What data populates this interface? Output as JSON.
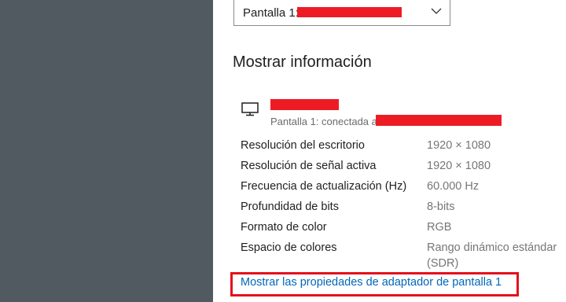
{
  "display_selector": {
    "label": "Pantalla 1:",
    "icon": "chevron-down-icon"
  },
  "section": {
    "title": "Mostrar información"
  },
  "display": {
    "icon": "monitor-icon",
    "connection": "Pantalla 1: conectada a"
  },
  "info_rows": [
    {
      "label": "Resolución del escritorio",
      "value": "1920 × 1080"
    },
    {
      "label": "Resolución de señal activa",
      "value": "1920 × 1080"
    },
    {
      "label": "Frecuencia de actualización (Hz)",
      "value": "60.000 Hz"
    },
    {
      "label": "Profundidad de bits",
      "value": "8-bits"
    },
    {
      "label": "Formato de color",
      "value": "RGB"
    },
    {
      "label": "Espacio de colores",
      "value": "Rango dinámico estándar",
      "value2": "(SDR)"
    }
  ],
  "adapter_link": {
    "label": "Mostrar las propiedades de adaptador de pantalla 1"
  },
  "colors": {
    "sidebar_bg": "#515a60",
    "redaction": "#ed1c24",
    "link": "#0067b8",
    "highlight_border": "#e4101c"
  }
}
